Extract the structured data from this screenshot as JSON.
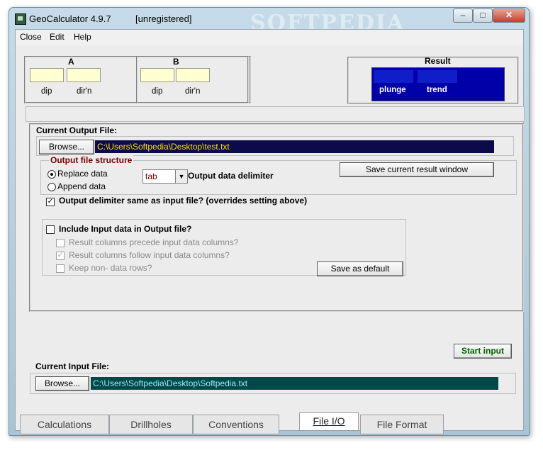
{
  "window": {
    "app_title": "GeoCalculator 4.9.7",
    "registration": "[unregistered]",
    "watermark": "SOFTPEDIA",
    "minimize": "–",
    "maximize": "□",
    "close": "✕"
  },
  "menu": [
    "Close",
    "Edit",
    "Help"
  ],
  "panel_a": {
    "title": "A",
    "label_dip": "dip",
    "label_dirn": "dir'n"
  },
  "panel_b": {
    "title": "B",
    "label_dip": "dip",
    "label_dirn": "dir'n"
  },
  "result": {
    "title": "Result",
    "label_plunge": "plunge",
    "label_trend": "trend"
  },
  "output": {
    "group_label": "Current Output File:",
    "browse_label": "Browse...",
    "path": "C:\\Users\\Softpedia\\Desktop\\test.txt",
    "structure_label": "Output file structure",
    "replace_label": "Replace data",
    "append_label": "Append data",
    "delimiter_value": "tab",
    "delimiter_label": "Output data delimiter",
    "save_result_label": "Save current result window",
    "same_delim_label": "Output delimiter same as input file? (overrides setting above)",
    "include_input_label": "Include Input data in Output file?",
    "precede_label": "Result columns precede input data columns?",
    "follow_label": "Result columns follow input data columns?",
    "keep_label": "Keep non- data rows?",
    "save_default_label": "Save as default",
    "start_input_label": "Start input"
  },
  "input": {
    "group_label": "Current Input File:",
    "browse_label": "Browse...",
    "path": "C:\\Users\\Softpedia\\Desktop\\Softpedia.txt"
  },
  "tabs": [
    "Calculations",
    "Drillholes",
    "Conventions",
    "File I/O",
    "File Format"
  ],
  "colors": {
    "output_path_bg": "#0b0b4a",
    "output_path_fg": "#ffe000",
    "input_path_bg": "#004747",
    "input_path_fg": "#8ef0ff",
    "result_bg": "#0000a8"
  }
}
